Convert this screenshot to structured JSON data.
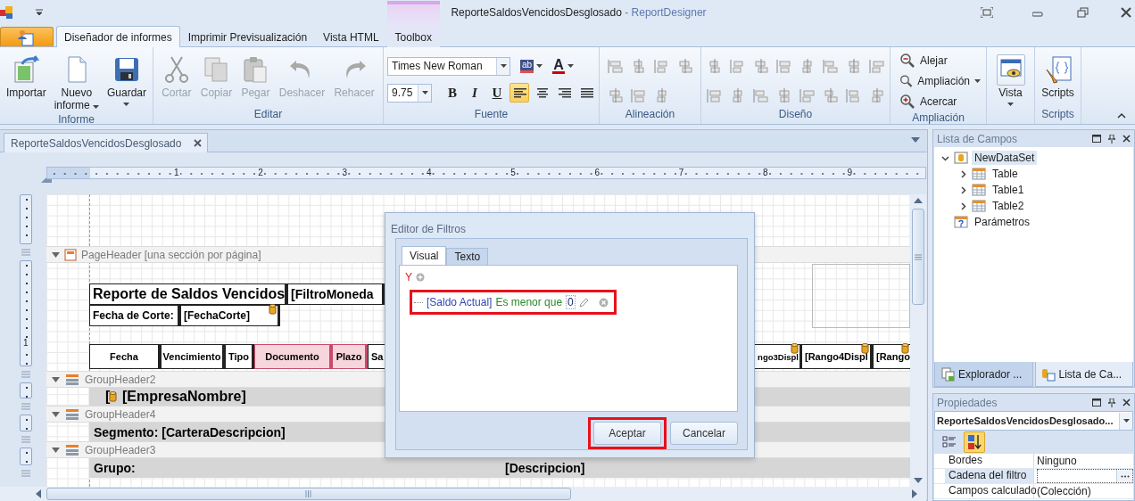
{
  "window": {
    "title": "ReporteSaldosVencidosDesglosado",
    "app_name": "- ReportDesigner"
  },
  "ribbon": {
    "tabs": [
      {
        "label": "Diseñador de informes",
        "selected": true,
        "contextual": false
      },
      {
        "label": "Imprimir Previsualización",
        "selected": false,
        "contextual": false
      },
      {
        "label": "Vista HTML",
        "selected": false,
        "contextual": false
      },
      {
        "label": "Toolbox",
        "selected": false,
        "contextual": true
      }
    ],
    "groups": [
      {
        "kind": "buttons",
        "label": "Informe",
        "items": [
          {
            "label": "Importar",
            "disabled": false,
            "dropdown": false
          },
          {
            "label": "Nuevo informe",
            "disabled": false,
            "dropdown": true
          },
          {
            "label": "Guardar",
            "disabled": false,
            "dropdown": true
          }
        ]
      },
      {
        "kind": "buttons",
        "label": "Editar",
        "items": [
          {
            "label": "Cortar",
            "disabled": true,
            "dropdown": false
          },
          {
            "label": "Copiar",
            "disabled": true,
            "dropdown": false
          },
          {
            "label": "Pegar",
            "disabled": true,
            "dropdown": false
          },
          {
            "label": "Deshacer",
            "disabled": true,
            "dropdown": false
          },
          {
            "label": "Rehacer",
            "disabled": true,
            "dropdown": false
          }
        ]
      },
      {
        "kind": "font",
        "label": "Fuente",
        "font": "Times New Roman",
        "size": "9.75",
        "highlight_label": "ab",
        "color_label": "A",
        "styles": [
          {
            "label": "B",
            "selected": false
          },
          {
            "label": "I",
            "selected": false
          },
          {
            "label": "U",
            "selected": false
          }
        ],
        "alignments": [
          {
            "selected": true
          },
          {
            "selected": false
          },
          {
            "selected": false
          },
          {
            "selected": false
          }
        ]
      },
      {
        "kind": "icons",
        "label": "Alineación"
      },
      {
        "kind": "icons",
        "label": "Diseño"
      },
      {
        "kind": "zoom",
        "label": "Ampliación",
        "items": [
          {
            "label": "Alejar",
            "dropdown": false
          },
          {
            "label": "Ampliación",
            "dropdown": true
          },
          {
            "label": "Acercar",
            "dropdown": false
          }
        ]
      },
      {
        "kind": "buttons",
        "items": [
          {
            "label": "Vista",
            "disabled": false,
            "dropdown": true
          }
        ]
      },
      {
        "kind": "buttons",
        "label": "Scripts",
        "items": [
          {
            "label": "Scripts",
            "disabled": false,
            "dropdown": false
          }
        ]
      }
    ]
  },
  "document_tabs": [
    {
      "label": "ReporteSaldosVencidosDesglosado",
      "selected": true
    }
  ],
  "ruler": {
    "marks": [
      "1",
      "2",
      "3",
      "4",
      "5",
      "6",
      "7",
      "8",
      "9"
    ]
  },
  "vertical_ruler": {
    "marks": [
      "1"
    ]
  },
  "report": {
    "bands": [
      {
        "kind": "page",
        "label": "PageHeader [una sección por página]",
        "expanded": true,
        "controls": [
          {
            "text": "Reporte de Saldos Vencidos"
          },
          {
            "text": "[FiltroMoneda"
          },
          {
            "text": "Fecha de Corte:"
          },
          {
            "text": "[FechaCorte]"
          },
          {
            "text": "Fecha",
            "highlighted": false
          },
          {
            "text": "Vencimiento",
            "highlighted": false
          },
          {
            "text": "Tipo",
            "highlighted": false
          },
          {
            "text": "Documento",
            "highlighted": true
          },
          {
            "text": "Plazo",
            "highlighted": true
          },
          {
            "text": "Sa",
            "highlighted": false
          },
          {
            "text": "ngo3Displ",
            "highlighted": false
          },
          {
            "text": "[Rango4Displ",
            "highlighted": false
          },
          {
            "text": "[Rango",
            "highlighted": false
          }
        ]
      },
      {
        "kind": "group",
        "label": "GroupHeader2",
        "expanded": true,
        "controls": [
          {
            "text": "["
          },
          {
            "text": "[EmpresaNombre]"
          }
        ]
      },
      {
        "kind": "group",
        "label": "GroupHeader4",
        "expanded": true,
        "controls": [
          {
            "text": "Segmento: [CarteraDescripcion]"
          }
        ]
      },
      {
        "kind": "group",
        "label": "GroupHeader3",
        "expanded": true,
        "controls": [
          {
            "text": "Grupo:"
          },
          {
            "text": "[Descripcion]"
          }
        ]
      }
    ]
  },
  "filter_dialog": {
    "title": "Editor de Filtros",
    "tabs": [
      {
        "label": "Visual",
        "selected": true
      },
      {
        "label": "Texto",
        "selected": false
      }
    ],
    "group_operator": "Y",
    "condition": {
      "field": "[Saldo Actual]",
      "operator": "Es menor que",
      "value": "0"
    },
    "buttons": [
      {
        "label": "Aceptar"
      },
      {
        "label": "Cancelar"
      }
    ]
  },
  "field_list": {
    "title": "Lista de Campos",
    "items": [
      {
        "label": "NewDataSet",
        "kind": "dataset",
        "expanded": true,
        "selected": true,
        "children": [
          {
            "label": "Table",
            "kind": "table",
            "expanded": false,
            "selected": false
          },
          {
            "label": "Table1",
            "kind": "table",
            "expanded": false,
            "selected": false
          },
          {
            "label": "Table2",
            "kind": "table",
            "expanded": false,
            "selected": false
          }
        ]
      },
      {
        "label": "Parámetros",
        "kind": "parameters",
        "selected": false
      }
    ],
    "tabs": [
      {
        "label": "Explorador ...",
        "selected": true
      },
      {
        "label": "Lista de Ca...",
        "selected": false
      }
    ]
  },
  "properties": {
    "title": "Propiedades",
    "object": "ReporteSaldosVencidosDesglosado...",
    "toolbar": [
      {
        "selected": false
      },
      {
        "selected": true
      }
    ],
    "rows": [
      {
        "name": "Bordes",
        "value": "Ninguno",
        "kind": "text",
        "selected": false
      },
      {
        "name": "Cadena del filtro",
        "kind": "ellipsis",
        "selected": true
      },
      {
        "name": "Campos calculado",
        "value": "(Colección)",
        "kind": "text",
        "selected": false
      }
    ]
  }
}
